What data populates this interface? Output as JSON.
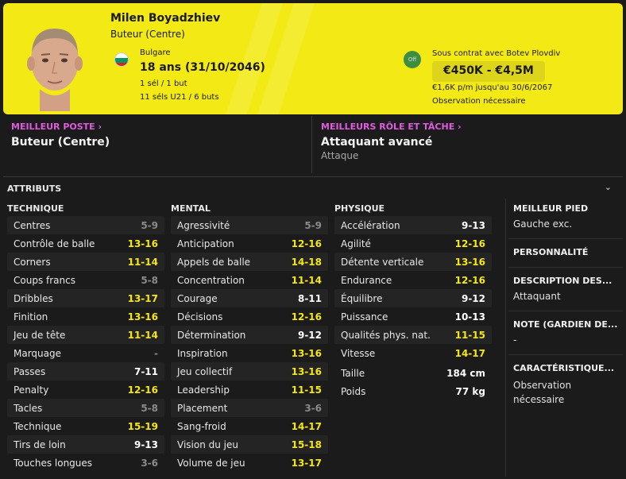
{
  "player": {
    "name": "Milen Boyadzhiev",
    "position": "Buteur (Centre)",
    "nation": "Bulgare",
    "age": "18 ans (31/10/2046)",
    "caps": "1 sél / 1 but",
    "u21_caps": "11 séls U21 / 6 buts",
    "off_badge": "Off",
    "contract": "Sous contrat avec Botev Plovdiv",
    "value": "€450K - €4,5M",
    "wage": "€1,6K p/m jusqu'au 30/6/2067",
    "scout_note": "Observation nécessaire"
  },
  "colors": {
    "header_bg": "#f3ea15",
    "accent": "#e15be2",
    "high_attr": "#f5e61b"
  },
  "best_position": {
    "label": "MEILLEUR POSTE",
    "value": "Buteur (Centre)"
  },
  "best_role": {
    "label": "MEILLEURS RÔLE ET TÂCHE",
    "value": "Attaquant avancé",
    "duty": "Attaque"
  },
  "attributes": {
    "title": "ATTRIBUTS",
    "technique": {
      "title": "TECHNIQUE",
      "items": [
        {
          "name": "Centres",
          "value": "5-9",
          "tone": "lo"
        },
        {
          "name": "Contrôle de balle",
          "value": "13-16",
          "tone": "hi"
        },
        {
          "name": "Corners",
          "value": "11-14",
          "tone": "hi"
        },
        {
          "name": "Coups francs",
          "value": "5-8",
          "tone": "lo"
        },
        {
          "name": "Dribbles",
          "value": "13-17",
          "tone": "hi"
        },
        {
          "name": "Finition",
          "value": "13-16",
          "tone": "hi"
        },
        {
          "name": "Jeu de tête",
          "value": "11-14",
          "tone": "hi"
        },
        {
          "name": "Marquage",
          "value": "-",
          "tone": "lo"
        },
        {
          "name": "Passes",
          "value": "7-11",
          "tone": "mid"
        },
        {
          "name": "Penalty",
          "value": "12-16",
          "tone": "hi"
        },
        {
          "name": "Tacles",
          "value": "5-8",
          "tone": "lo"
        },
        {
          "name": "Technique",
          "value": "15-19",
          "tone": "hi"
        },
        {
          "name": "Tirs de loin",
          "value": "9-13",
          "tone": "mid"
        },
        {
          "name": "Touches longues",
          "value": "3-6",
          "tone": "lo"
        }
      ]
    },
    "mental": {
      "title": "MENTAL",
      "items": [
        {
          "name": "Agressivité",
          "value": "5-9",
          "tone": "lo"
        },
        {
          "name": "Anticipation",
          "value": "12-16",
          "tone": "hi"
        },
        {
          "name": "Appels de balle",
          "value": "14-18",
          "tone": "hi"
        },
        {
          "name": "Concentration",
          "value": "11-14",
          "tone": "hi"
        },
        {
          "name": "Courage",
          "value": "8-11",
          "tone": "mid"
        },
        {
          "name": "Décisions",
          "value": "12-16",
          "tone": "hi"
        },
        {
          "name": "Détermination",
          "value": "9-12",
          "tone": "mid"
        },
        {
          "name": "Inspiration",
          "value": "13-16",
          "tone": "hi"
        },
        {
          "name": "Jeu collectif",
          "value": "13-16",
          "tone": "hi"
        },
        {
          "name": "Leadership",
          "value": "11-15",
          "tone": "hi"
        },
        {
          "name": "Placement",
          "value": "3-6",
          "tone": "lo"
        },
        {
          "name": "Sang-froid",
          "value": "14-17",
          "tone": "hi"
        },
        {
          "name": "Vision du jeu",
          "value": "15-18",
          "tone": "hi"
        },
        {
          "name": "Volume de jeu",
          "value": "13-17",
          "tone": "hi"
        }
      ]
    },
    "physique": {
      "title": "PHYSIQUE",
      "items": [
        {
          "name": "Accélération",
          "value": "9-13",
          "tone": "mid"
        },
        {
          "name": "Agilité",
          "value": "12-16",
          "tone": "hi"
        },
        {
          "name": "Détente verticale",
          "value": "13-16",
          "tone": "hi"
        },
        {
          "name": "Endurance",
          "value": "12-16",
          "tone": "hi"
        },
        {
          "name": "Équilibre",
          "value": "9-12",
          "tone": "mid"
        },
        {
          "name": "Puissance",
          "value": "10-13",
          "tone": "mid"
        },
        {
          "name": "Qualités phys. nat.",
          "value": "11-15",
          "tone": "hi"
        },
        {
          "name": "Vitesse",
          "value": "14-17",
          "tone": "hi"
        }
      ],
      "extra": [
        {
          "name": "Taille",
          "value": "184 cm"
        },
        {
          "name": "Poids",
          "value": "77 kg"
        }
      ]
    }
  },
  "side": {
    "preferred_foot_label": "MEILLEUR PIED",
    "preferred_foot": "Gauche exc.",
    "personality_label": "PERSONNALITÉ",
    "description_label": "DESCRIPTION DES...",
    "description": "Attaquant",
    "gk_rating_label": "NOTE (GARDIEN DE...",
    "gk_rating": "-",
    "traits_label": "CARACTÉRISTIQUE...",
    "traits": "Observation nécessaire"
  }
}
